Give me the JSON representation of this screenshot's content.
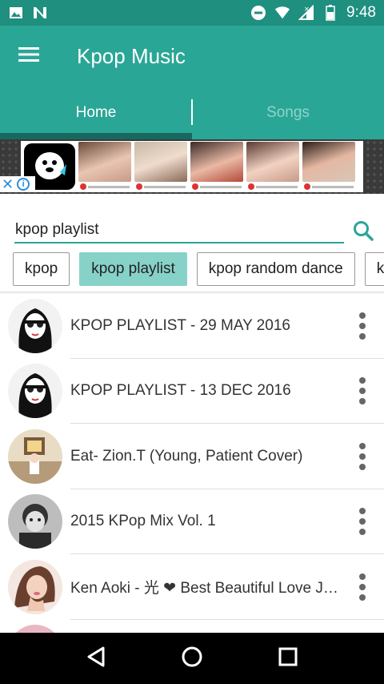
{
  "status_bar": {
    "time": "9:48",
    "icons": [
      "image-icon",
      "n-app-icon",
      "do-not-disturb-icon",
      "wifi-icon",
      "signal-icon",
      "battery-icon"
    ]
  },
  "app_bar": {
    "title": "Kpop Music",
    "menu_icon": "hamburger-menu-icon",
    "color": "#2aa696"
  },
  "tabs": [
    {
      "label": "Home",
      "selected": true
    },
    {
      "label": "Songs",
      "selected": false
    }
  ],
  "ad": {
    "close_label": "✕",
    "info_label": "i"
  },
  "search": {
    "value": "kpop playlist",
    "icon": "search-icon"
  },
  "chips": [
    {
      "label": "kpop",
      "selected": false
    },
    {
      "label": "kpop playlist",
      "selected": true
    },
    {
      "label": "kpop random dance",
      "selected": false
    },
    {
      "label": "kp",
      "selected": false
    }
  ],
  "results": [
    {
      "title": "KPOP PLAYLIST - 29 MAY 2016"
    },
    {
      "title": "KPOP PLAYLIST - 13 DEC 2016"
    },
    {
      "title": "Eat- Zion.T (Young, Patient Cover)"
    },
    {
      "title": "2015 KPop Mix Vol. 1"
    },
    {
      "title": "Ken Aoki - 光 ❤ Best Beautiful Love J-Pop Songs"
    }
  ],
  "nav": {
    "back_icon": "back-triangle-icon",
    "home_icon": "home-circle-icon",
    "recents_icon": "recents-square-icon"
  },
  "colors": {
    "status_bar": "#1f8f80",
    "primary": "#2aa696",
    "tab_indicator": "#17695f",
    "chip_selected": "#86d2c8"
  }
}
